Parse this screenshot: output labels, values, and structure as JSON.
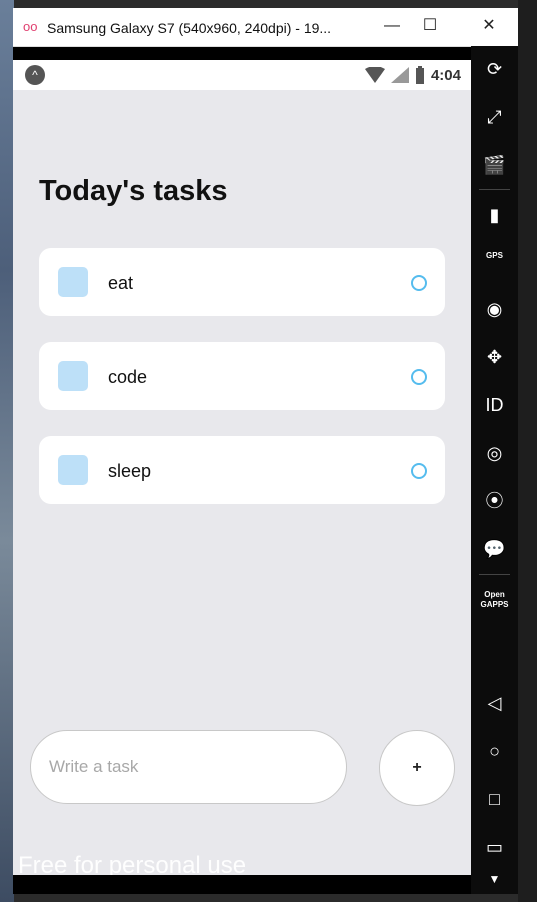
{
  "window": {
    "title": "Samsung Galaxy S7 (540x960, 240dpi) - 19...",
    "logo_glyph": "oo",
    "minimize_glyph": "—",
    "maximize_glyph": "☐",
    "close_glyph": "✕"
  },
  "statusbar": {
    "time": "4:04",
    "app_glyph": "^"
  },
  "app": {
    "heading": "Today's tasks",
    "tasks": [
      {
        "label": "eat"
      },
      {
        "label": "code"
      },
      {
        "label": "sleep"
      }
    ],
    "input": {
      "placeholder": "Write a task",
      "value": ""
    },
    "add_button_label": "+",
    "watermark": "Free for personal use"
  },
  "toolbar": {
    "rotate": "⟳",
    "resize": "⤢",
    "media": "🎬",
    "battery": "▮",
    "gps": "GPS",
    "camera": "◉",
    "move": "✥",
    "id": "ID",
    "disk": "◎",
    "cast": "⦿",
    "message": "💬",
    "open_gapps": "Open GAPPS",
    "back": "◁",
    "home": "○",
    "recents": "□",
    "keyboard": "▭",
    "more": "▼"
  },
  "colors": {
    "screen_bg": "#e8e8ec",
    "checkbox": "#bde0f8",
    "circle_accent": "#55bcee"
  }
}
